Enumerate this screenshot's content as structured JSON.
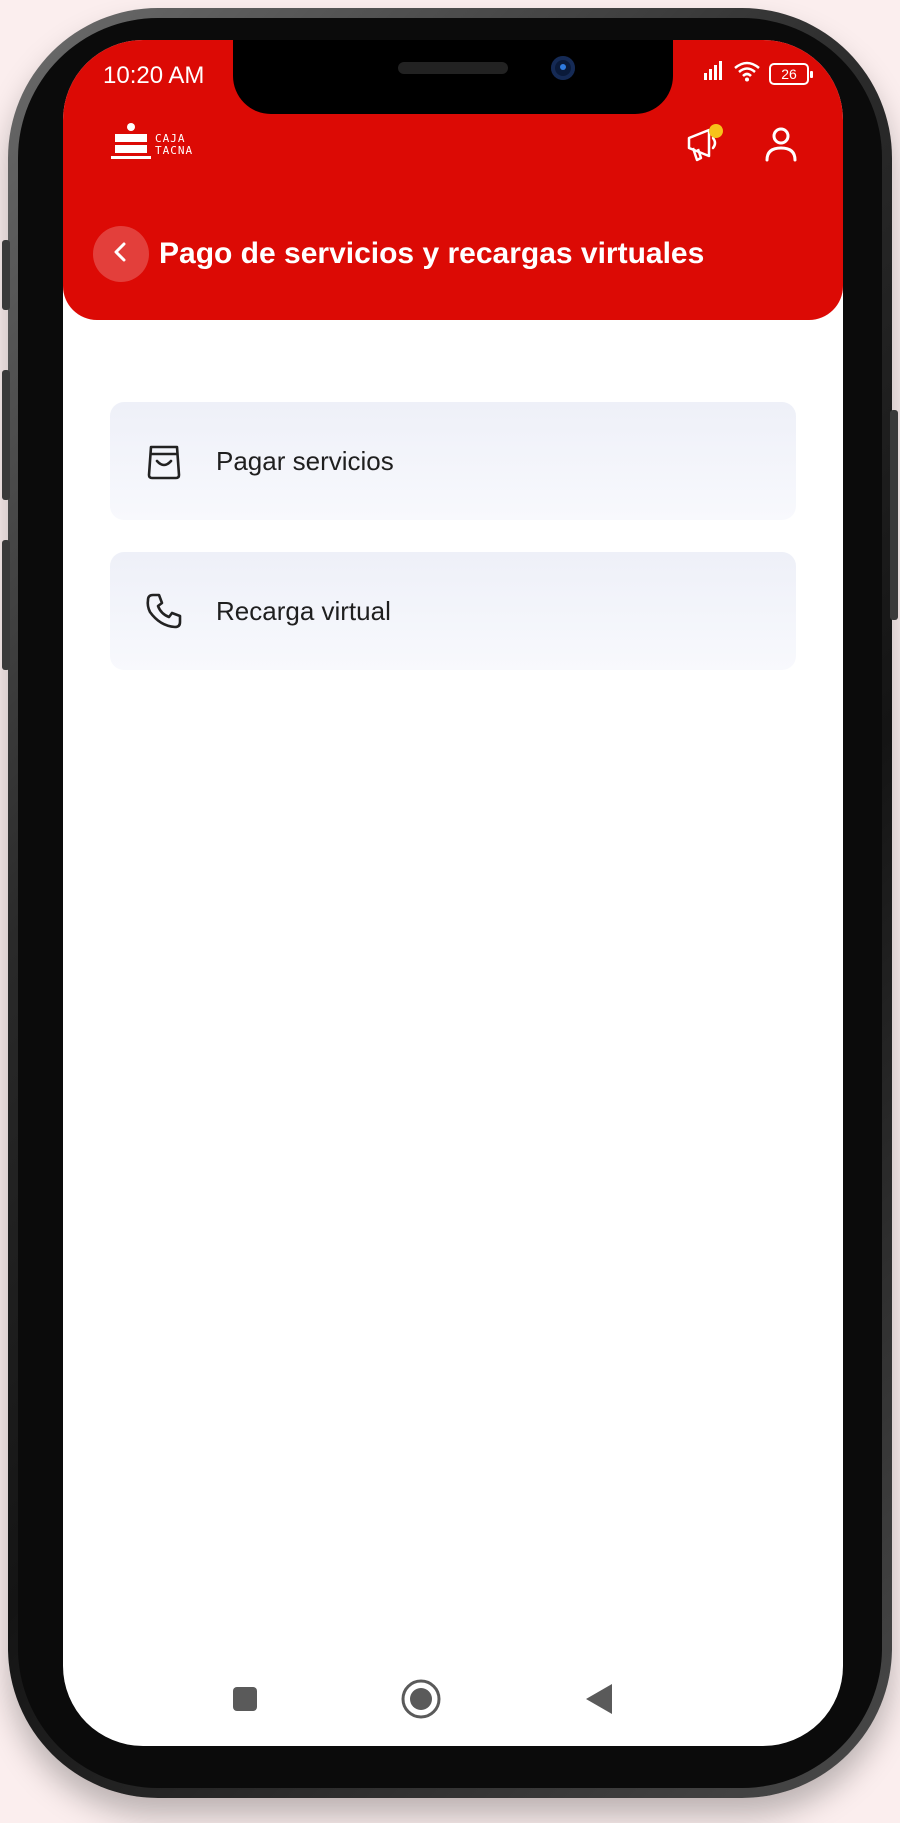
{
  "status_bar": {
    "time": "10:20 AM",
    "battery": "26"
  },
  "header": {
    "logo_line1": "CAJA",
    "logo_line2": "TACNA",
    "title": "Pago de servicios y recargas virtuales"
  },
  "menu": {
    "items": [
      {
        "label": "Pagar servicios",
        "icon": "shopping-bag-icon"
      },
      {
        "label": "Recarga virtual",
        "icon": "phone-icon"
      }
    ]
  },
  "colors": {
    "brand_red": "#dc0a05",
    "notification_dot": "#f7c21a",
    "card_bg": "#eef0f8"
  },
  "navbar": {
    "icons": [
      "recent-apps-icon",
      "home-icon",
      "back-icon"
    ]
  }
}
